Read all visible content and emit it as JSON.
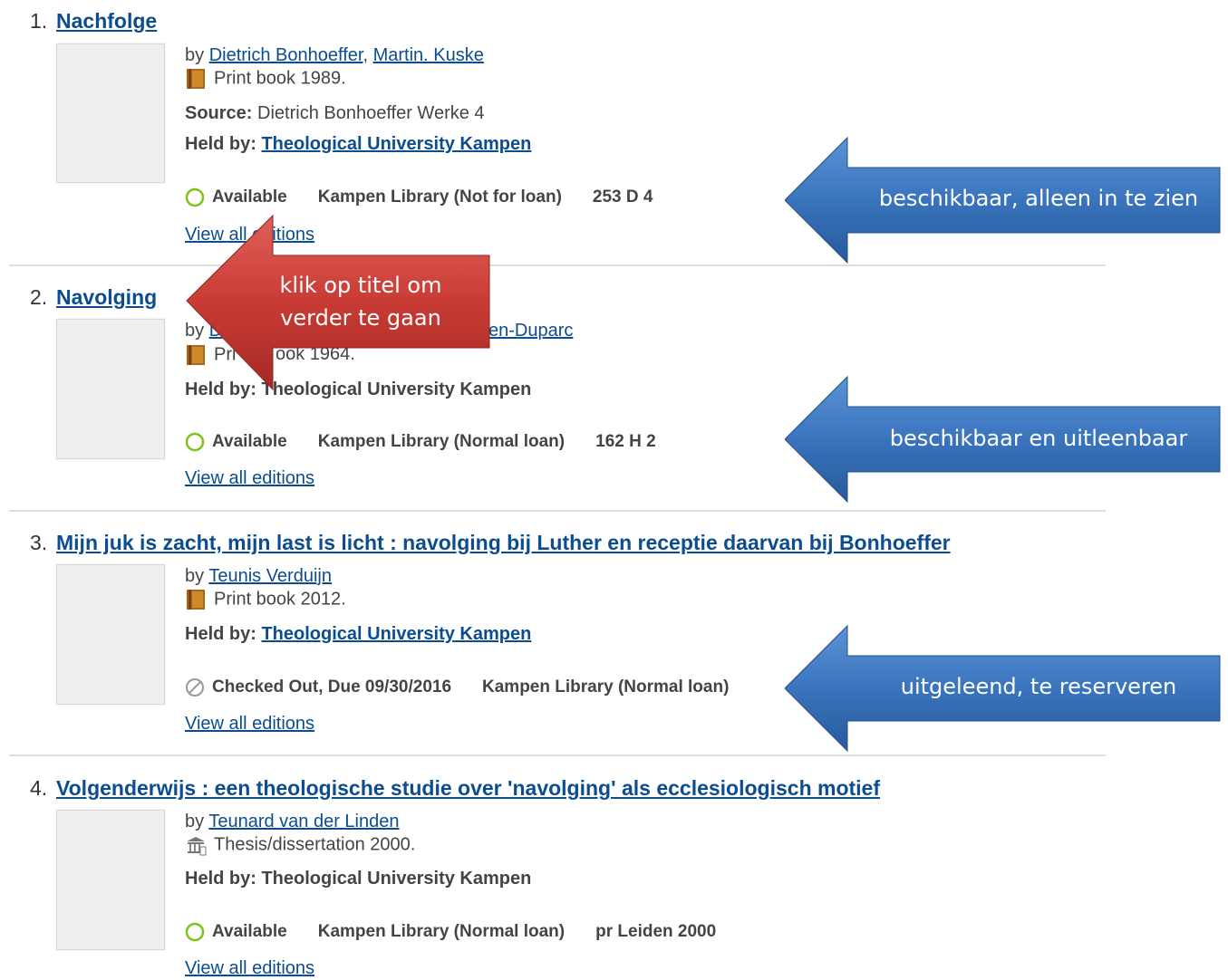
{
  "results": [
    {
      "number": "1.",
      "title": "Nachfolge",
      "by_prefix": "by",
      "authors": [
        "Dietrich Bonhoeffer",
        "Martin. Kuske"
      ],
      "format_icon": "book-icon",
      "format": "Print book 1989.",
      "source_label": "Source:",
      "source_value": "Dietrich Bonhoeffer Werke 4",
      "held_label": "Held by:",
      "held_value": "Theological University Kampen",
      "status_icon": "available-circle-icon",
      "status": "Available",
      "location": "Kampen Library (Not for loan)",
      "call_number": "253 D 4",
      "view_all": "View all editions"
    },
    {
      "number": "2.",
      "title": "Navolging",
      "by_prefix": "by",
      "authors_visible": [
        "D",
        "en-Duparc"
      ],
      "format_icon": "book-icon",
      "format_visible_left": "Pri",
      "format_visible_right": "ook 1964.",
      "held_label": "Held by:",
      "held_visible_left": "T",
      "held_visible_right": "heological University Kampen",
      "status_icon": "available-circle-icon",
      "status": "Available",
      "location": "Kampen Library (Normal loan)",
      "call_number": "162 H 2",
      "view_all": "View all editions"
    },
    {
      "number": "3.",
      "title": "Mijn juk is zacht, mijn last is licht : navolging bij Luther en receptie daarvan bij Bonhoeffer",
      "by_prefix": "by",
      "authors": [
        "Teunis Verduijn"
      ],
      "format_icon": "book-icon",
      "format": "Print book 2012.",
      "held_label": "Held by:",
      "held_value": "Theological University Kampen",
      "status_icon": "checked-out-icon",
      "status": "Checked Out, Due 09/30/2016",
      "location": "Kampen Library (Normal loan)",
      "view_all": "View all editions"
    },
    {
      "number": "4.",
      "title": "Volgenderwijs : een theologische studie over 'navolging' als ecclesiologisch motief",
      "by_prefix": "by",
      "authors": [
        "Teunard van der Linden"
      ],
      "format_icon": "thesis-icon",
      "format": "Thesis/dissertation 2000.",
      "held_label": "Held by:",
      "held_value": "Theological University Kampen",
      "status_icon": "available-circle-icon",
      "status": "Available",
      "location": "Kampen Library (Normal loan)",
      "call_number": "pr Leiden 2000",
      "view_all": "View all editions"
    }
  ],
  "annotations": {
    "red_arrow": {
      "line1": "klik op titel om",
      "line2": "verder te gaan",
      "color": "#c0392b"
    },
    "blue_arrow_1": {
      "text": "beschikbaar, alleen in te zien",
      "color": "#2f6fb8"
    },
    "blue_arrow_2": {
      "text": "beschikbaar en uitleenbaar",
      "color": "#2f6fb8"
    },
    "blue_arrow_3": {
      "text": "uitgeleend, te reserveren",
      "color": "#2f6fb8"
    }
  },
  "colors": {
    "link": "#0b4d8f",
    "available": "#7cc21a",
    "text": "#444444"
  }
}
